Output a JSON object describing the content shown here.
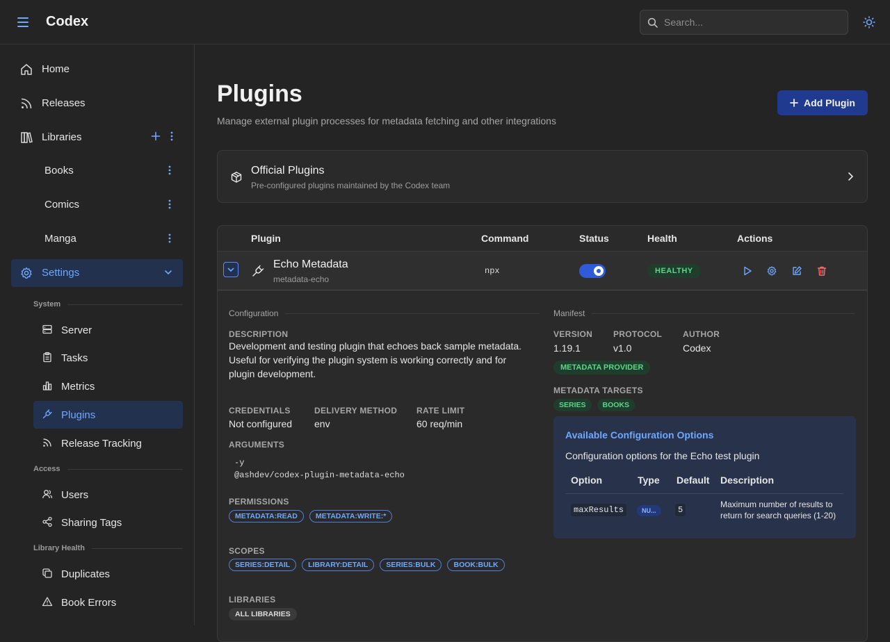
{
  "header": {
    "app_title": "Codex",
    "search_placeholder": "Search..."
  },
  "sidebar": {
    "home": "Home",
    "releases": "Releases",
    "libraries": "Libraries",
    "library_items": [
      "Books",
      "Comics",
      "Manga"
    ],
    "settings": "Settings",
    "section_system": "System",
    "system_items": [
      "Server",
      "Tasks",
      "Metrics",
      "Plugins",
      "Release Tracking"
    ],
    "section_access": "Access",
    "access_items": [
      "Users",
      "Sharing Tags"
    ],
    "section_library_health": "Library Health",
    "health_items": [
      "Duplicates",
      "Book Errors"
    ]
  },
  "page": {
    "title": "Plugins",
    "subtitle": "Manage external plugin processes for metadata fetching and other integrations",
    "add_button": "Add Plugin"
  },
  "official": {
    "title": "Official Plugins",
    "subtitle": "Pre-configured plugins maintained by the Codex team"
  },
  "table": {
    "headers": [
      "Plugin",
      "Command",
      "Status",
      "Health",
      "Actions"
    ],
    "row": {
      "name": "Echo Metadata",
      "id": "metadata-echo",
      "command": "npx",
      "health": "HEALTHY",
      "enabled": true
    }
  },
  "detail": {
    "configuration_title": "Configuration",
    "description_label": "DESCRIPTION",
    "description": "Development and testing plugin that echoes back sample metadata. Useful for verifying the plugin system is working correctly and for plugin development.",
    "credentials_label": "CREDENTIALS",
    "credentials": "Not configured",
    "delivery_label": "DELIVERY METHOD",
    "delivery": "env",
    "rate_label": "RATE LIMIT",
    "rate": "60 req/min",
    "arguments_label": "ARGUMENTS",
    "arguments": [
      "-y",
      "@ashdev/codex-plugin-metadata-echo"
    ],
    "permissions_label": "PERMISSIONS",
    "permissions": [
      "METADATA:READ",
      "METADATA:WRITE:*"
    ],
    "scopes_label": "SCOPES",
    "scopes": [
      "SERIES:DETAIL",
      "LIBRARY:DETAIL",
      "SERIES:BULK",
      "BOOK:BULK"
    ],
    "libraries_label": "LIBRARIES",
    "libraries": [
      "ALL LIBRARIES"
    ],
    "manifest_title": "Manifest",
    "version_label": "VERSION",
    "version": "1.19.1",
    "protocol_label": "PROTOCOL",
    "protocol": "v1.0",
    "author_label": "AUTHOR",
    "author": "Codex",
    "capability": "METADATA PROVIDER",
    "targets_label": "METADATA TARGETS",
    "targets": [
      "SERIES",
      "BOOKS"
    ]
  },
  "config_options": {
    "title": "Available Configuration Options",
    "subtitle": "Configuration options for the Echo test plugin",
    "headers": [
      "Option",
      "Type",
      "Default",
      "Description"
    ],
    "rows": [
      {
        "option": "maxResults",
        "type": "NU...",
        "default": "5",
        "description": "Maximum number of results to return for search queries (1-20)"
      }
    ]
  },
  "colors": {
    "accent": "#6ea8ff",
    "primary_button": "#1f3a8f",
    "healthy": "#5fd38a",
    "danger": "#ff6b6b"
  }
}
